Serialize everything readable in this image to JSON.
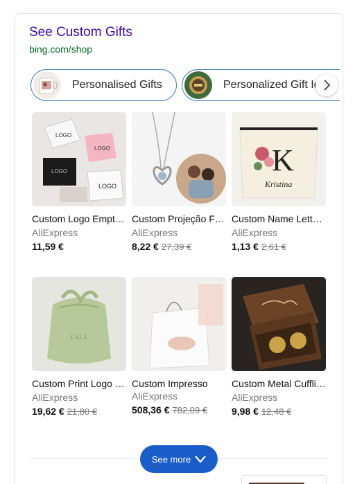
{
  "header": {
    "title": "See Custom Gifts",
    "url": "bing.com/shop"
  },
  "chips": [
    {
      "label": "Personalised Gifts"
    },
    {
      "label": "Personalized Gift Ideas"
    }
  ],
  "products": [
    {
      "name": "Custom Logo Empty Jewelry Box Packaging",
      "seller": "AliExpress",
      "price": "11,59 €",
      "old_price": ""
    },
    {
      "name": "Custom Projeção Foto Colar, Personalizado",
      "seller": "AliExpress",
      "price": "8,22 €",
      "old_price": "27,39 €"
    },
    {
      "name": "Custom Name Letters Makeup Bag",
      "seller": "AliExpress",
      "price": "1,13 €",
      "old_price": "2,61 €"
    },
    {
      "name": "Custom Print Logo Satin Jóias Embalagem",
      "seller": "AliExpress",
      "price": "19,62 €",
      "old_price": "21,80 €"
    },
    {
      "name": "Custom Impresso",
      "seller": "AliExpress",
      "price": "508,36 €",
      "old_price": "782,09 €"
    },
    {
      "name": "Custom Metal Cufflinks Set, Tie Clip",
      "seller": "AliExpress",
      "price": "9,98 €",
      "old_price": "12,48 €"
    }
  ],
  "image_text": {
    "logo1": "LOGO",
    "logo2": "LOGO",
    "logo3": "LOGO",
    "logo4": "LOGO",
    "bag_letter": "K",
    "bag_name": "Kristina",
    "pouch_text": "LALA"
  },
  "footer": {
    "see_more_label": "See more"
  },
  "colors": {
    "title": "#4007a2",
    "url": "#006d21",
    "chip_border": "#3c79c8",
    "see_more_bg": "#1a5dc8"
  }
}
